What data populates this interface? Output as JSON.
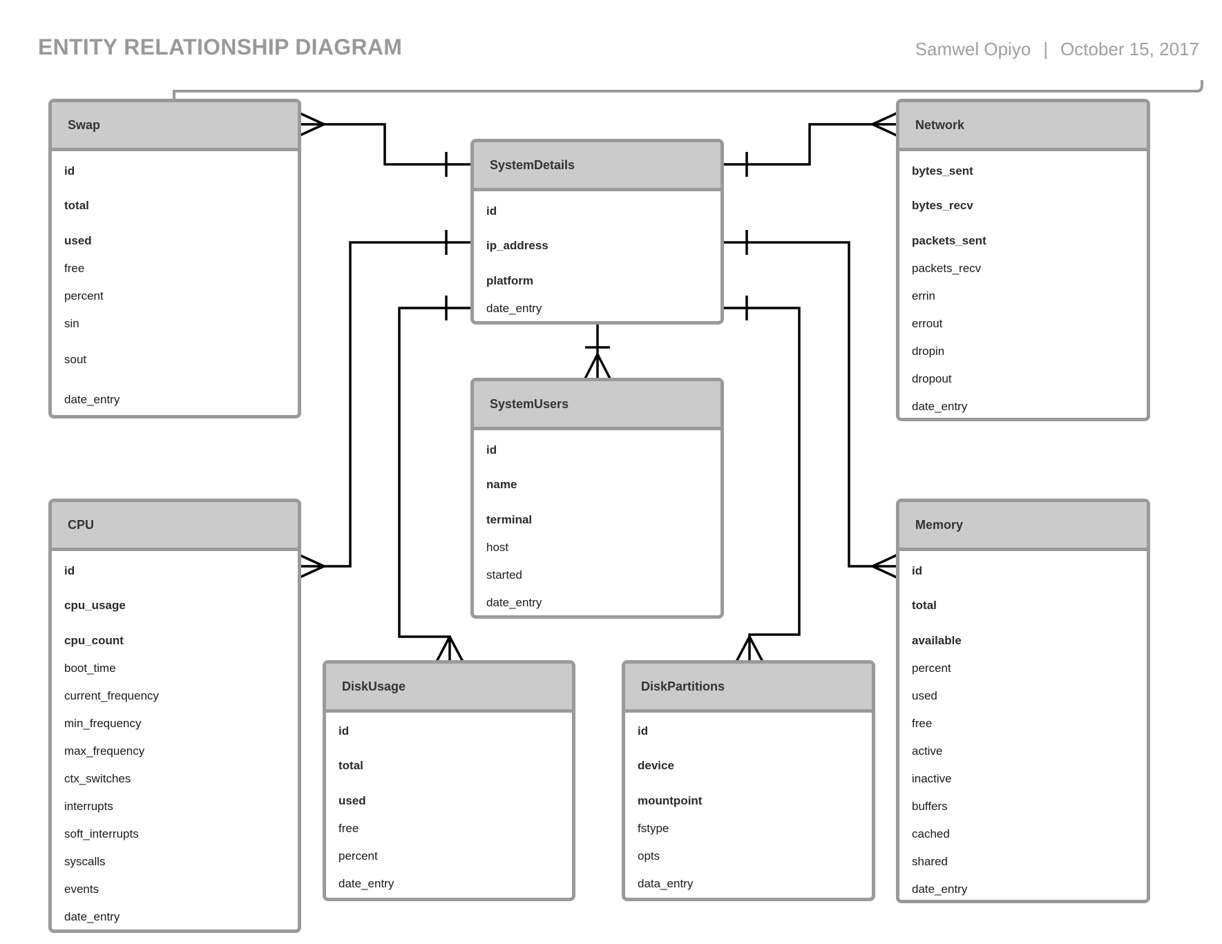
{
  "title": "ENTITY RELATIONSHIP DIAGRAM",
  "author": "Samwel Opiyo",
  "separator": "|",
  "date": "October 15, 2017",
  "colors": {
    "border": "#9a9a9a",
    "header": "#cbcbcb",
    "line": "#000000",
    "title": "#999999"
  },
  "entities": [
    {
      "id": "swap",
      "name": "Swap",
      "fields": [
        {
          "name": "id",
          "key": true
        },
        {
          "name": "total",
          "key": true
        },
        {
          "name": "used",
          "key": true
        },
        {
          "name": "free"
        },
        {
          "name": "percent"
        },
        {
          "name": "sin"
        },
        {
          "name": "sout"
        },
        {
          "name": "date_entry"
        }
      ]
    },
    {
      "id": "system-details",
      "name": "SystemDetails",
      "fields": [
        {
          "name": "id",
          "key": true
        },
        {
          "name": "ip_address",
          "key": true
        },
        {
          "name": "platform",
          "key": true
        },
        {
          "name": "date_entry"
        }
      ]
    },
    {
      "id": "network",
      "name": "Network",
      "fields": [
        {
          "name": "bytes_sent",
          "key": true
        },
        {
          "name": "bytes_recv",
          "key": true
        },
        {
          "name": "packets_sent",
          "key": true
        },
        {
          "name": "packets_recv"
        },
        {
          "name": "errin"
        },
        {
          "name": "errout"
        },
        {
          "name": "dropin"
        },
        {
          "name": "dropout"
        },
        {
          "name": "date_entry"
        }
      ]
    },
    {
      "id": "system-users",
      "name": "SystemUsers",
      "fields": [
        {
          "name": "id",
          "key": true
        },
        {
          "name": "name",
          "key": true
        },
        {
          "name": "terminal",
          "key": true
        },
        {
          "name": "host"
        },
        {
          "name": "started"
        },
        {
          "name": "date_entry"
        }
      ]
    },
    {
      "id": "cpu",
      "name": "CPU",
      "fields": [
        {
          "name": "id",
          "key": true
        },
        {
          "name": "cpu_usage",
          "key": true
        },
        {
          "name": "cpu_count",
          "key": true
        },
        {
          "name": "boot_time"
        },
        {
          "name": "current_frequency"
        },
        {
          "name": "min_frequency"
        },
        {
          "name": "max_frequency"
        },
        {
          "name": "ctx_switches"
        },
        {
          "name": "interrupts"
        },
        {
          "name": "soft_interrupts"
        },
        {
          "name": "syscalls"
        },
        {
          "name": "events"
        },
        {
          "name": "date_entry"
        }
      ]
    },
    {
      "id": "memory",
      "name": "Memory",
      "fields": [
        {
          "name": "id",
          "key": true
        },
        {
          "name": "total",
          "key": true
        },
        {
          "name": "available",
          "key": true
        },
        {
          "name": "percent"
        },
        {
          "name": "used"
        },
        {
          "name": "free"
        },
        {
          "name": "active"
        },
        {
          "name": "inactive"
        },
        {
          "name": "buffers"
        },
        {
          "name": "cached"
        },
        {
          "name": "shared"
        },
        {
          "name": "date_entry"
        }
      ]
    },
    {
      "id": "disk-usage",
      "name": "DiskUsage",
      "fields": [
        {
          "name": "id",
          "key": true
        },
        {
          "name": "total",
          "key": true
        },
        {
          "name": "used",
          "key": true
        },
        {
          "name": "free"
        },
        {
          "name": "percent"
        },
        {
          "name": "date_entry"
        }
      ]
    },
    {
      "id": "disk-partitions",
      "name": "DiskPartitions",
      "fields": [
        {
          "name": "id",
          "key": true
        },
        {
          "name": "device",
          "key": true
        },
        {
          "name": "mountpoint",
          "key": true
        },
        {
          "name": "fstype"
        },
        {
          "name": "opts"
        },
        {
          "name": "data_entry"
        }
      ]
    }
  ],
  "relationships": [
    {
      "from": "SystemDetails",
      "from_card": "one",
      "to": "Swap",
      "to_card": "many"
    },
    {
      "from": "SystemDetails",
      "from_card": "one",
      "to": "Network",
      "to_card": "many"
    },
    {
      "from": "SystemDetails",
      "from_card": "one",
      "to": "CPU",
      "to_card": "many"
    },
    {
      "from": "SystemDetails",
      "from_card": "one",
      "to": "Memory",
      "to_card": "many"
    },
    {
      "from": "SystemDetails",
      "from_card": "one",
      "to": "DiskUsage",
      "to_card": "many"
    },
    {
      "from": "SystemDetails",
      "from_card": "one",
      "to": "DiskPartitions",
      "to_card": "many"
    },
    {
      "from": "SystemDetails",
      "from_card": "one",
      "to": "SystemUsers",
      "to_card": "many"
    }
  ]
}
